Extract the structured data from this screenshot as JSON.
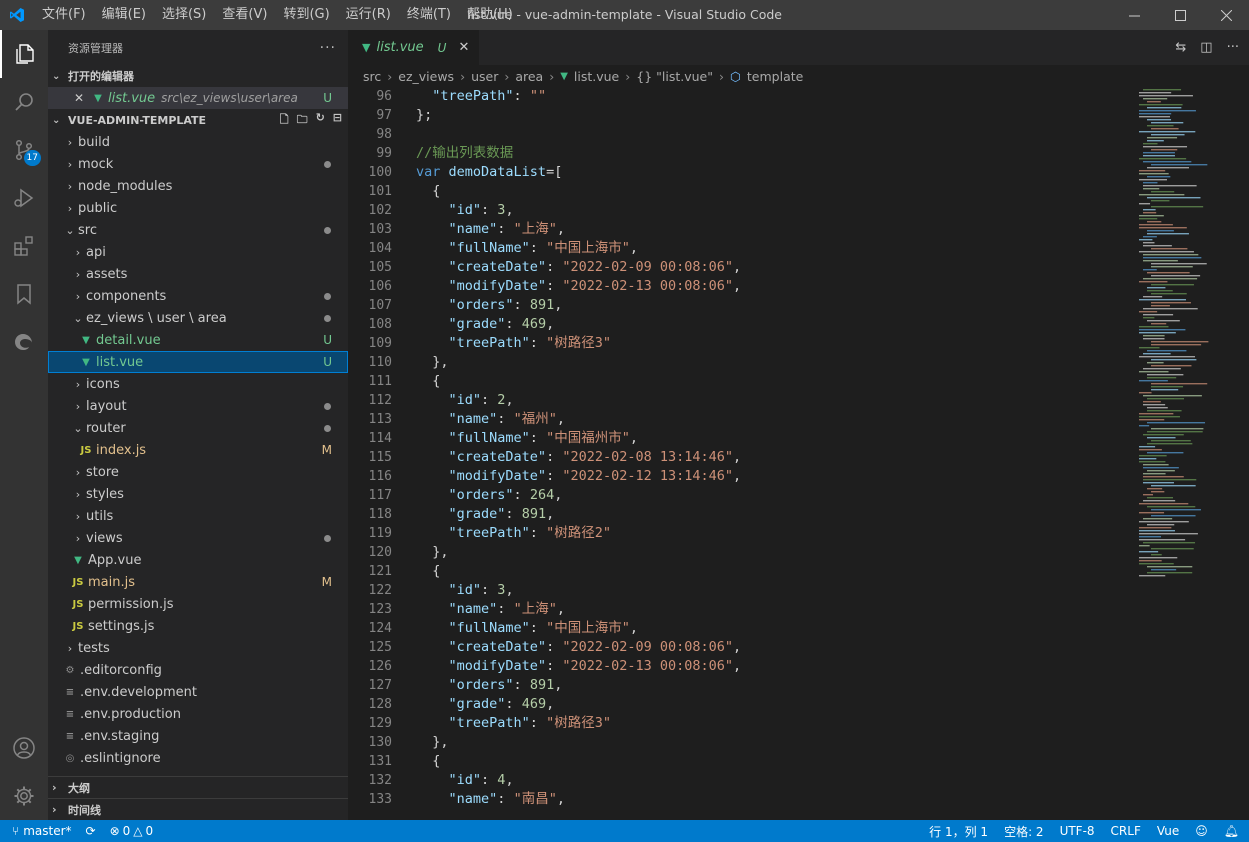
{
  "window": {
    "title": "list.vue - vue-admin-template - Visual Studio Code",
    "menu": [
      "文件(F)",
      "编辑(E)",
      "选择(S)",
      "查看(V)",
      "转到(G)",
      "运行(R)",
      "终端(T)",
      "帮助(H)"
    ]
  },
  "activity": {
    "scm_badge": "17"
  },
  "sidebar": {
    "title": "资源管理器",
    "open_editors": {
      "header": "打开的编辑器",
      "file_name": "list.vue",
      "file_path": "src\\ez_views\\user\\area",
      "status": "U"
    },
    "project": {
      "header": "VUE-ADMIN-TEMPLATE",
      "items": [
        {
          "label": "build"
        },
        {
          "label": "mock"
        },
        {
          "label": "node_modules"
        },
        {
          "label": "public"
        },
        {
          "label": "src"
        },
        {
          "label": "api"
        },
        {
          "label": "assets"
        },
        {
          "label": "components"
        },
        {
          "label": "ez_views \\ user \\ area"
        },
        {
          "label": "detail.vue",
          "status": "U"
        },
        {
          "label": "list.vue",
          "status": "U"
        },
        {
          "label": "icons"
        },
        {
          "label": "layout"
        },
        {
          "label": "router"
        },
        {
          "label": "index.js",
          "status": "M"
        },
        {
          "label": "store"
        },
        {
          "label": "styles"
        },
        {
          "label": "utils"
        },
        {
          "label": "views"
        },
        {
          "label": "App.vue"
        },
        {
          "label": "main.js",
          "status": "M"
        },
        {
          "label": "permission.js"
        },
        {
          "label": "settings.js"
        },
        {
          "label": "tests"
        },
        {
          "label": ".editorconfig"
        },
        {
          "label": ".env.development"
        },
        {
          "label": ".env.production"
        },
        {
          "label": ".env.staging"
        },
        {
          "label": ".eslintignore"
        }
      ]
    },
    "outline": "大纲",
    "timeline": "时间线"
  },
  "editor": {
    "tab": {
      "label": "list.vue",
      "status": "U"
    },
    "breadcrumb": [
      "src",
      "ez_views",
      "user",
      "area",
      "list.vue",
      "{} \"list.vue\"",
      "template"
    ]
  },
  "statusbar": {
    "branch": "master*",
    "errors": "0",
    "warnings": "0",
    "position": "行 1，列 1",
    "spaces": "空格: 2",
    "encoding": "UTF-8",
    "eol": "CRLF",
    "language": "Vue"
  }
}
